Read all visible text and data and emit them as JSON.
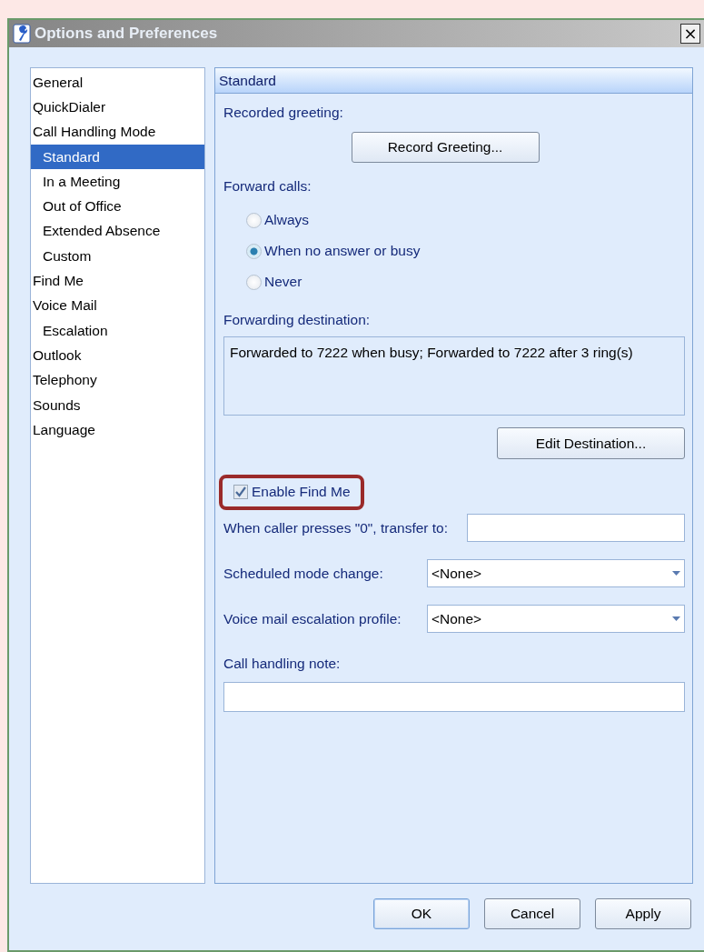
{
  "window": {
    "title": "Options and Preferences",
    "close": "×"
  },
  "sidebar": {
    "items": [
      {
        "label": "General",
        "selected": false
      },
      {
        "label": "QuickDialer",
        "selected": false
      },
      {
        "label": "Call Handling Mode",
        "selected": false,
        "children": [
          {
            "label": "Standard",
            "selected": true
          },
          {
            "label": "In a Meeting",
            "selected": false
          },
          {
            "label": "Out of Office",
            "selected": false
          },
          {
            "label": "Extended Absence",
            "selected": false
          },
          {
            "label": "Custom",
            "selected": false
          }
        ]
      },
      {
        "label": "Find Me",
        "selected": false
      },
      {
        "label": "Voice Mail",
        "selected": false,
        "children": [
          {
            "label": "Escalation",
            "selected": false
          }
        ]
      },
      {
        "label": "Outlook",
        "selected": false
      },
      {
        "label": "Telephony",
        "selected": false
      },
      {
        "label": "Sounds",
        "selected": false
      },
      {
        "label": "Language",
        "selected": false
      }
    ]
  },
  "panel": {
    "title": "Standard",
    "recorded_greeting": {
      "label": "Recorded greeting:",
      "button": "Record Greeting..."
    },
    "forward_calls": {
      "label": "Forward calls:",
      "options": [
        {
          "label": "Always",
          "selected": false
        },
        {
          "label": "When no answer or busy",
          "selected": true
        },
        {
          "label": "Never",
          "selected": false
        }
      ]
    },
    "forwarding_destination": {
      "label": "Forwarding destination:",
      "value": "Forwarded to 7222 when busy; Forwarded to 7222 after 3 ring(s)",
      "button": "Edit Destination..."
    },
    "enable_find_me": {
      "label": "Enable Find Me",
      "checked": true,
      "highlighted": true
    },
    "fields": [
      {
        "kind": "text",
        "label": "When caller presses \"0\", transfer to:"
      },
      {
        "kind": "dropdown",
        "label": "Scheduled mode change:",
        "value": "<None>"
      },
      {
        "kind": "dropdown",
        "label": "Voice mail escalation profile:",
        "value": "<None>"
      }
    ],
    "note": {
      "label": "Call handling note:"
    }
  },
  "buttons": [
    {
      "label": "OK",
      "default": true
    },
    {
      "label": "Cancel",
      "default": false
    },
    {
      "label": "Apply",
      "default": false
    }
  ]
}
